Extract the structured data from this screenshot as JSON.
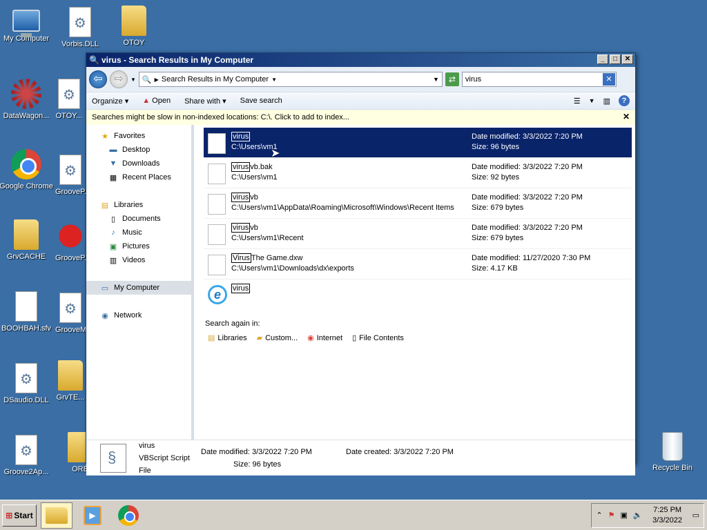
{
  "desktop": {
    "icons": [
      {
        "label": "My Computer"
      },
      {
        "label": "Vorbis.DLL"
      },
      {
        "label": "OTOY"
      },
      {
        "label": "DataWagon..."
      },
      {
        "label": "OTOY..."
      },
      {
        "label": "Google Chrome"
      },
      {
        "label": "GrooveP..."
      },
      {
        "label": "GrvCACHE"
      },
      {
        "label": "GrooveP..."
      },
      {
        "label": "BOOHBAH.sfv"
      },
      {
        "label": "GrooveM..."
      },
      {
        "label": "DSaudio.DLL"
      },
      {
        "label": "GrvTE..."
      },
      {
        "label": "Groove2Ap..."
      },
      {
        "label": "ORB"
      },
      {
        "label": "Recycle Bin"
      }
    ]
  },
  "window": {
    "title": "virus - Search Results in My Computer",
    "address": "Search Results in My Computer",
    "search_value": "virus",
    "minimize": "_",
    "maximize": "□",
    "close": "✕"
  },
  "toolbar": {
    "organize": "Organize ▾",
    "open": "Open",
    "share_with": "Share with ▾",
    "save_search": "Save search"
  },
  "infobar": {
    "text": "Searches might be slow in non-indexed locations: C:\\. Click to add to index..."
  },
  "nav": {
    "favorites": "Favorites",
    "desktop": "Desktop",
    "downloads": "Downloads",
    "recent_places": "Recent Places",
    "libraries": "Libraries",
    "documents": "Documents",
    "music": "Music",
    "pictures": "Pictures",
    "videos": "Videos",
    "my_computer": "My Computer",
    "network": "Network"
  },
  "results": [
    {
      "match": "virus",
      "rest": "",
      "path": "C:\\Users\\vm1",
      "date": "Date modified: 3/3/2022 7:20 PM",
      "size": "Size: 96 bytes"
    },
    {
      "match": "virus",
      "rest": "vb.bak",
      "path": "C:\\Users\\vm1",
      "date": "Date modified: 3/3/2022 7:20 PM",
      "size": "Size: 92 bytes"
    },
    {
      "match": "virus",
      "rest": "vb",
      "path": "C:\\Users\\vm1\\AppData\\Roaming\\Microsoft\\Windows\\Recent Items",
      "date": "Date modified: 3/3/2022 7:20 PM",
      "size": "Size: 679 bytes"
    },
    {
      "match": "virus",
      "rest": "vb",
      "path": "C:\\Users\\vm1\\Recent",
      "date": "Date modified: 3/3/2022 7:20 PM",
      "size": "Size: 679 bytes"
    },
    {
      "match": "Virus",
      "rest": "The Game.dxw",
      "path": "C:\\Users\\vm1\\Downloads\\dx\\exports",
      "date": "Date modified: 11/27/2020 7:30 PM",
      "size": "Size: 4.17 KB"
    },
    {
      "match": "virus",
      "rest": ""
    }
  ],
  "search_again": {
    "label": "Search again in:",
    "libraries": "Libraries",
    "custom": "Custom...",
    "internet": "Internet",
    "file_contents": "File Contents"
  },
  "details": {
    "name": "virus",
    "type": "VBScript Script File",
    "date_modified_label": "Date modified:",
    "date_modified": "3/3/2022 7:20 PM",
    "size_label": "Size:",
    "size": "96 bytes",
    "date_created_label": "Date created:",
    "date_created": "3/3/2022 7:20 PM"
  },
  "taskbar": {
    "start": "Start",
    "time": "7:25 PM",
    "date": "3/3/2022"
  }
}
